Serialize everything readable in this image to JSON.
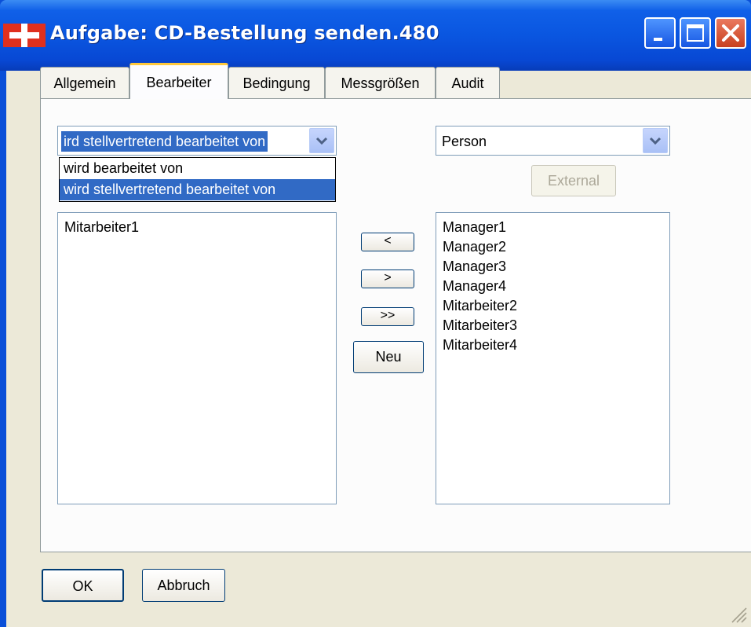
{
  "window": {
    "title": "Aufgabe: CD-Bestellung senden.480",
    "controls": [
      "minimize-icon",
      "maximize-icon",
      "close-icon"
    ]
  },
  "tabs": [
    {
      "label": "Allgemein",
      "active": false
    },
    {
      "label": "Bearbeiter",
      "active": true
    },
    {
      "label": "Bedingung",
      "active": false
    },
    {
      "label": "Messgrößen",
      "active": false
    },
    {
      "label": "Audit",
      "active": false
    }
  ],
  "left_combo": {
    "value": "ird stellvertretend bearbeitet von",
    "options": [
      "wird bearbeitet von",
      "wird stellvertretend bearbeitet von"
    ],
    "highlighted_index": 1
  },
  "right_combo": {
    "value": "Person"
  },
  "external_button": {
    "label": "External",
    "enabled": false
  },
  "left_list": {
    "items": [
      "Mitarbeiter1"
    ]
  },
  "right_list": {
    "items": [
      "Manager1",
      "Manager2",
      "Manager3",
      "Manager4",
      "Mitarbeiter2",
      "Mitarbeiter3",
      "Mitarbeiter4"
    ]
  },
  "transfer_buttons": {
    "left": "<",
    "right": ">",
    "all_right": ">>",
    "new": "Neu"
  },
  "footer": {
    "ok": "OK",
    "cancel": "Abbruch"
  },
  "colors": {
    "titlebar": "#0a56e0",
    "selection": "#316ac5",
    "tab_highlight": "#ffc83c",
    "close_button": "#c8401f"
  }
}
